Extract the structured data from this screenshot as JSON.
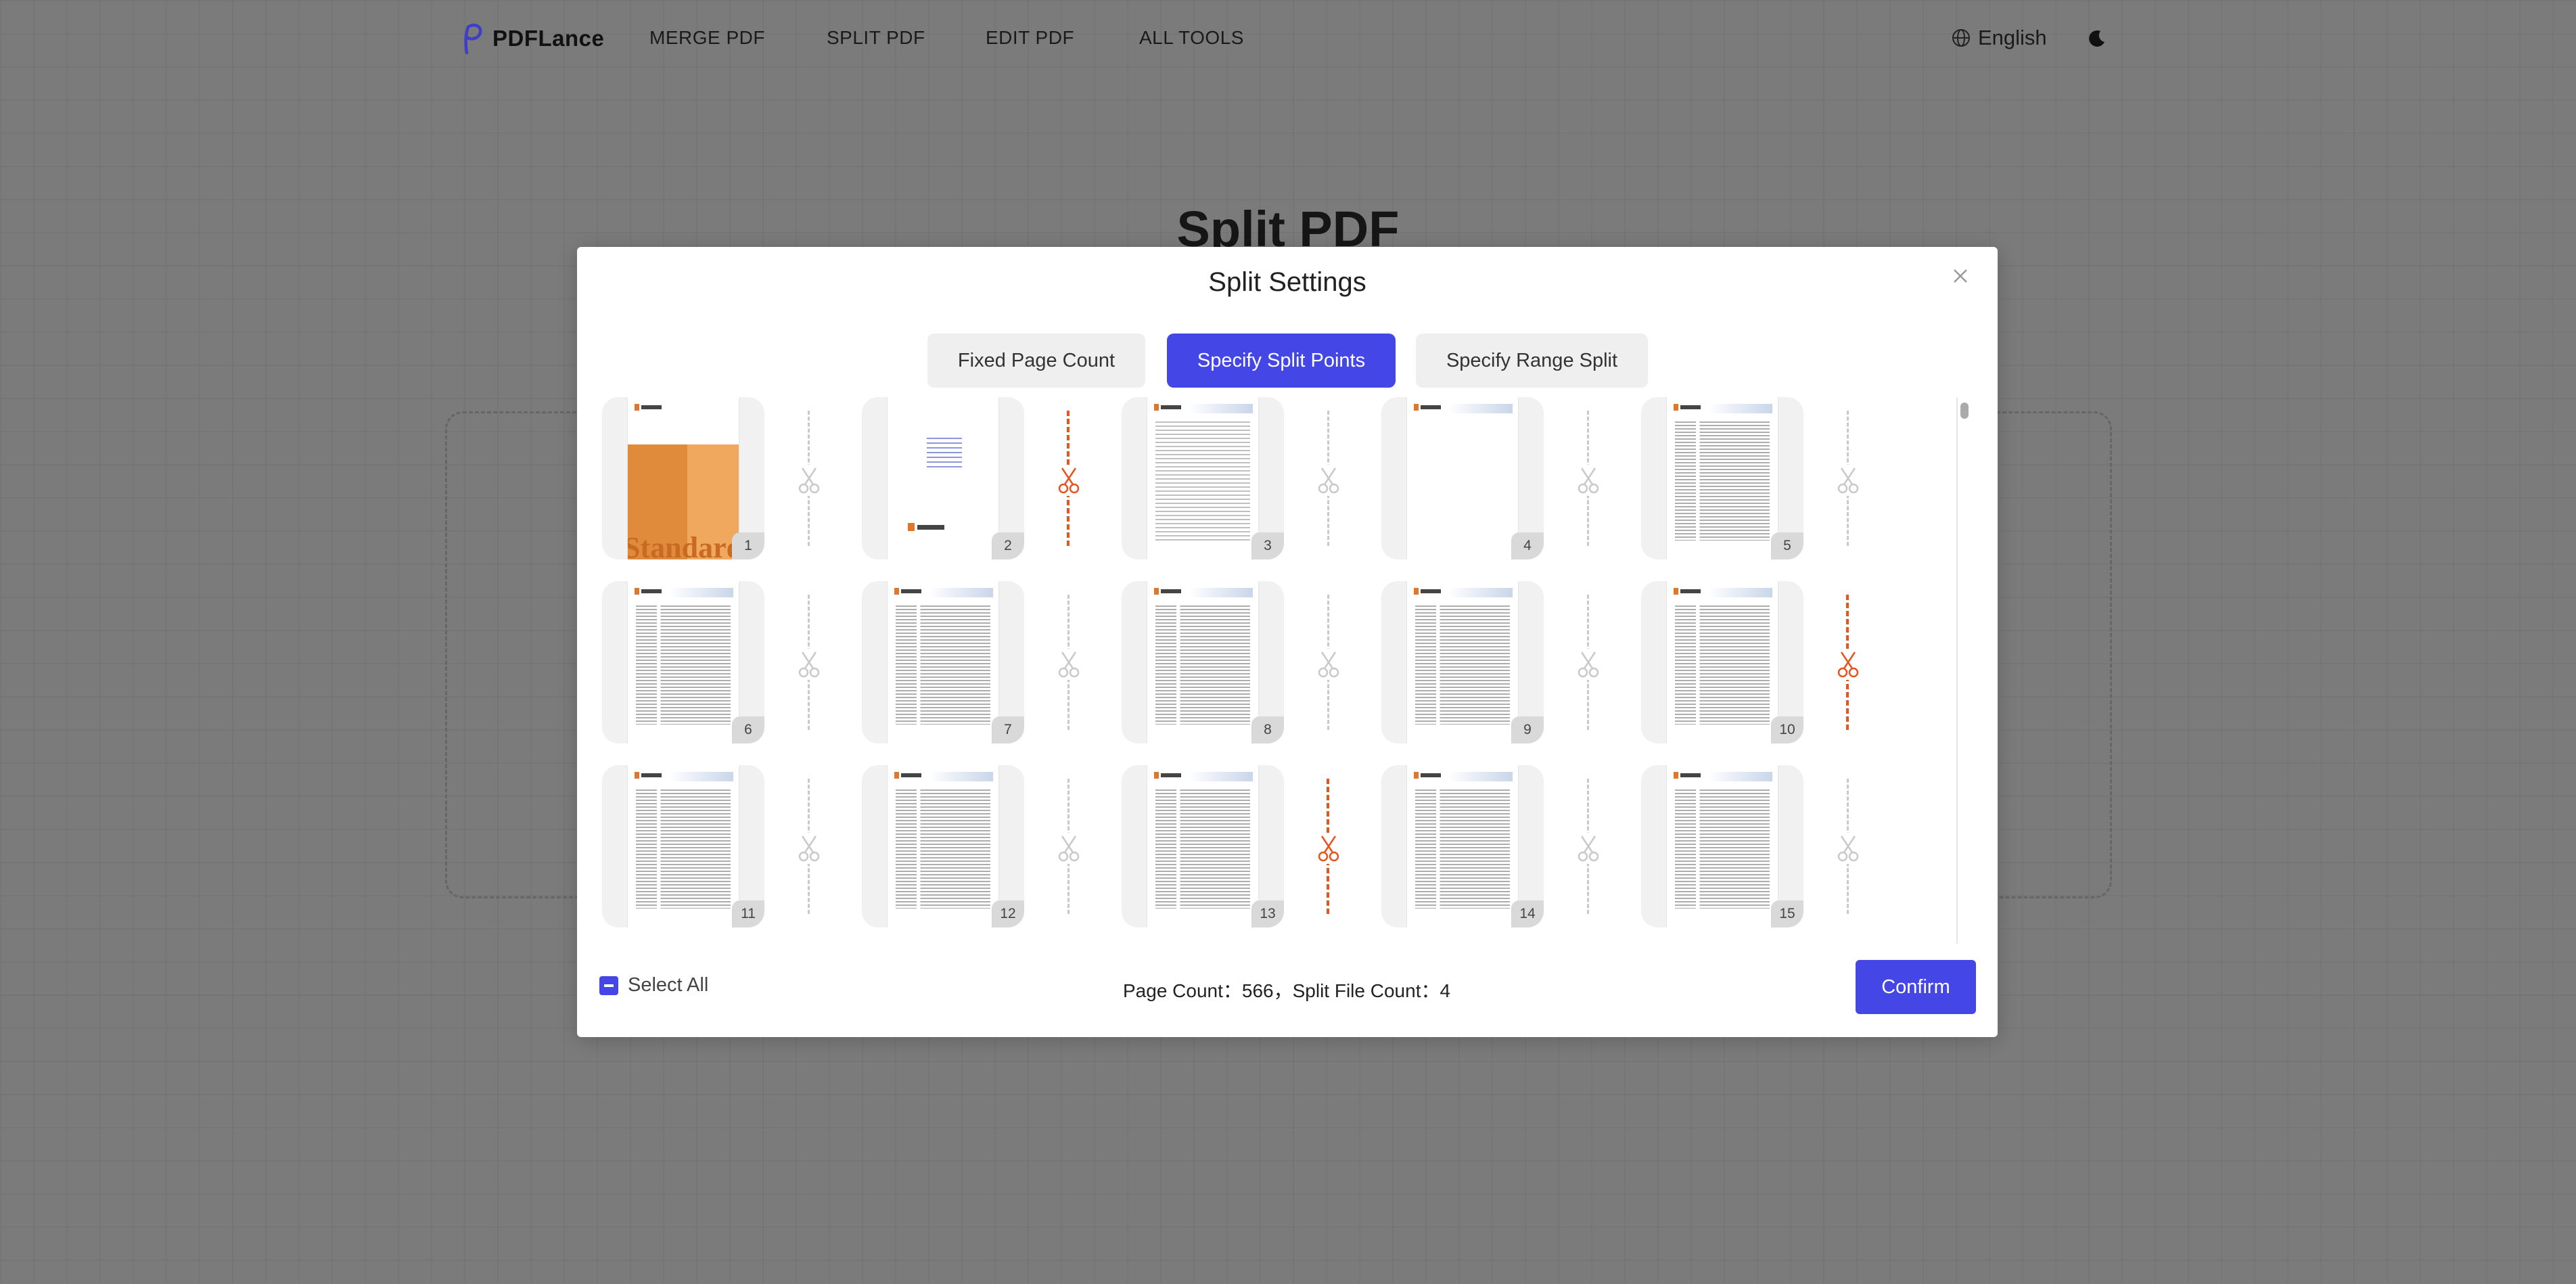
{
  "header": {
    "logo_text": "PDFLance",
    "nav": [
      {
        "label": "MERGE PDF"
      },
      {
        "label": "SPLIT PDF"
      },
      {
        "label": "EDIT PDF"
      },
      {
        "label": "ALL TOOLS"
      }
    ],
    "language": "English"
  },
  "background": {
    "title": "Split PDF"
  },
  "modal": {
    "title": "Split Settings",
    "tabs": [
      {
        "label": "Fixed Page Count",
        "active": false
      },
      {
        "label": "Specify Split Points",
        "active": true
      },
      {
        "label": "Specify Range Split",
        "active": false
      }
    ],
    "pages": [
      {
        "number": "1",
        "split_after": false
      },
      {
        "number": "2",
        "split_after": true
      },
      {
        "number": "3",
        "split_after": false
      },
      {
        "number": "4",
        "split_after": false
      },
      {
        "number": "5",
        "split_after": false
      },
      {
        "number": "6",
        "split_after": false
      },
      {
        "number": "7",
        "split_after": false
      },
      {
        "number": "8",
        "split_after": false
      },
      {
        "number": "9",
        "split_after": false
      },
      {
        "number": "10",
        "split_after": true
      },
      {
        "number": "11",
        "split_after": false
      },
      {
        "number": "12",
        "split_after": false
      },
      {
        "number": "13",
        "split_after": true
      },
      {
        "number": "14",
        "split_after": false
      },
      {
        "number": "15",
        "split_after": false
      }
    ],
    "footer": {
      "select_all_label": "Select All",
      "select_all_state": "indeterminate",
      "counts_text": "Page Count：566，Split File Count：4",
      "confirm_label": "Confirm"
    }
  },
  "colors": {
    "accent": "#4447e6",
    "split_active": "#e8541e",
    "split_inactive": "#c9c9c9",
    "overlay": "#7b7b7b"
  }
}
